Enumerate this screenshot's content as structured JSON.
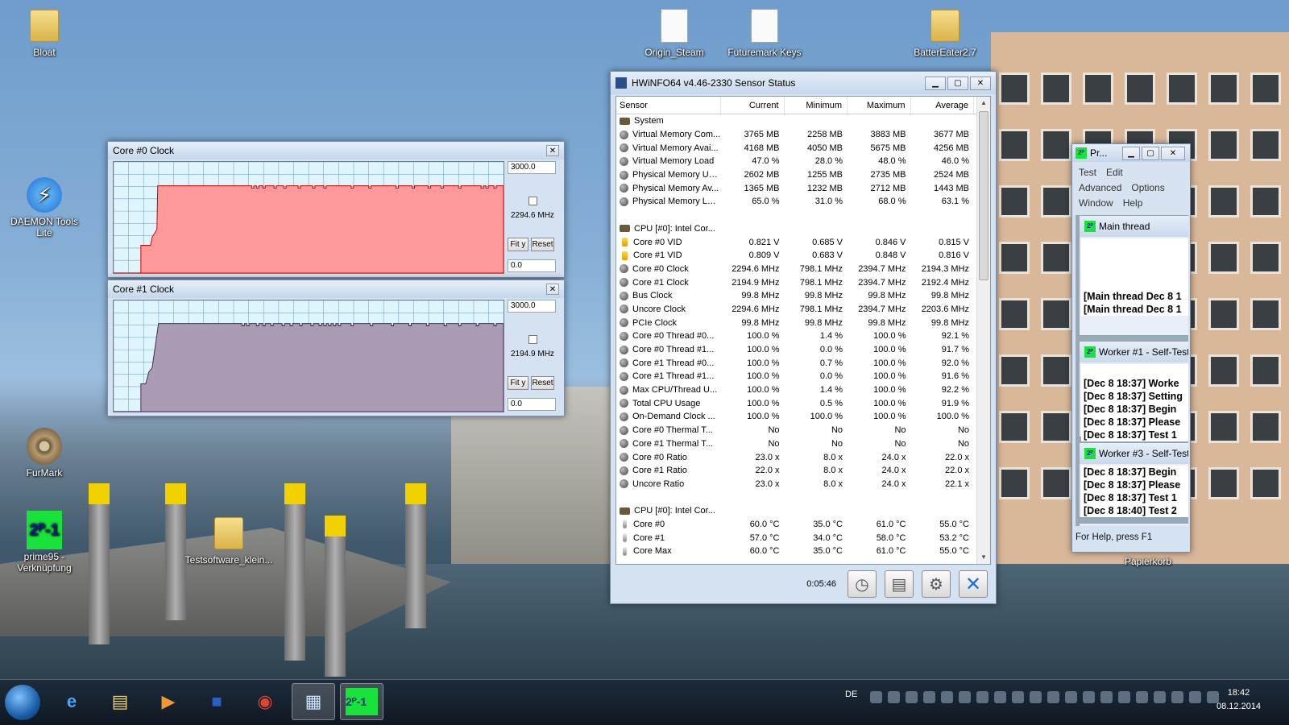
{
  "desktop": {
    "icons": [
      {
        "label": "Bloat",
        "icon": "folder-icon"
      },
      {
        "label": "Origin_Steam",
        "icon": "document-icon"
      },
      {
        "label": "Futuremark Keys",
        "icon": "document-icon"
      },
      {
        "label": "BatterEater2.7",
        "icon": "folder-icon"
      },
      {
        "label": "DAEMON Tools Lite",
        "icon": "daemon-tools-icon"
      },
      {
        "label": "FurMark",
        "icon": "furmark-icon"
      },
      {
        "label": "prime95 - Verknüpfung",
        "icon": "prime95-icon"
      },
      {
        "label": "Testsoftware_klein...",
        "icon": "folder-icon"
      },
      {
        "label": "Papierkorb",
        "icon": "recycle-bin-icon"
      }
    ]
  },
  "graphs": [
    {
      "title": "Core #0 Clock",
      "max": "3000.0",
      "current": "2294.6 MHz",
      "min": "0.0",
      "fit_label": "Fit y",
      "reset_label": "Reset",
      "fill": "#ff9a9a",
      "stroke": "#d40000"
    },
    {
      "title": "Core #1 Clock",
      "max": "3000.0",
      "current": "2194.9 MHz",
      "min": "0.0",
      "fit_label": "Fit y",
      "reset_label": "Reset",
      "fill": "#a99cb3",
      "stroke": "#4a2a58"
    }
  ],
  "hwinfo": {
    "title": "HWiNFO64 v4.46-2330 Sensor Status",
    "columns": [
      "Sensor",
      "Current",
      "Minimum",
      "Maximum",
      "Average"
    ],
    "rows": [
      {
        "icon": "group",
        "cells": [
          "System",
          "",
          "",
          "",
          ""
        ]
      },
      {
        "icon": "sensor",
        "cells": [
          "Virtual Memory Com...",
          "3765 MB",
          "2258 MB",
          "3883 MB",
          "3677 MB"
        ]
      },
      {
        "icon": "sensor",
        "cells": [
          "Virtual Memory Avai...",
          "4168 MB",
          "4050 MB",
          "5675 MB",
          "4256 MB"
        ]
      },
      {
        "icon": "sensor",
        "cells": [
          "Virtual Memory Load",
          "47.0 %",
          "28.0 %",
          "48.0 %",
          "46.0 %"
        ]
      },
      {
        "icon": "sensor",
        "cells": [
          "Physical Memory Used",
          "2602 MB",
          "1255 MB",
          "2735 MB",
          "2524 MB"
        ]
      },
      {
        "icon": "sensor",
        "cells": [
          "Physical Memory Av...",
          "1365 MB",
          "1232 MB",
          "2712 MB",
          "1443 MB"
        ]
      },
      {
        "icon": "sensor",
        "cells": [
          "Physical Memory Load",
          "65.0 %",
          "31.0 %",
          "68.0 %",
          "63.1 %"
        ]
      },
      {
        "icon": "none",
        "cells": [
          "",
          "",
          "",
          "",
          ""
        ]
      },
      {
        "icon": "group",
        "cells": [
          "CPU [#0]: Intel Cor...",
          "",
          "",
          "",
          ""
        ]
      },
      {
        "icon": "volt",
        "cells": [
          "Core #0 VID",
          "0.821 V",
          "0.685 V",
          "0.846 V",
          "0.815 V"
        ]
      },
      {
        "icon": "volt",
        "cells": [
          "Core #1 VID",
          "0.809 V",
          "0.683 V",
          "0.848 V",
          "0.816 V"
        ]
      },
      {
        "icon": "sensor",
        "cells": [
          "Core #0 Clock",
          "2294.6 MHz",
          "798.1 MHz",
          "2394.7 MHz",
          "2194.3 MHz"
        ]
      },
      {
        "icon": "sensor",
        "cells": [
          "Core #1 Clock",
          "2194.9 MHz",
          "798.1 MHz",
          "2394.7 MHz",
          "2192.4 MHz"
        ]
      },
      {
        "icon": "sensor",
        "cells": [
          "Bus Clock",
          "99.8 MHz",
          "99.8 MHz",
          "99.8 MHz",
          "99.8 MHz"
        ]
      },
      {
        "icon": "sensor",
        "cells": [
          "Uncore Clock",
          "2294.6 MHz",
          "798.1 MHz",
          "2394.7 MHz",
          "2203.6 MHz"
        ]
      },
      {
        "icon": "sensor",
        "cells": [
          "PCIe Clock",
          "99.8 MHz",
          "99.8 MHz",
          "99.8 MHz",
          "99.8 MHz"
        ]
      },
      {
        "icon": "sensor",
        "cells": [
          "Core #0 Thread #0...",
          "100.0 %",
          "1.4 %",
          "100.0 %",
          "92.1 %"
        ]
      },
      {
        "icon": "sensor",
        "cells": [
          "Core #0 Thread #1...",
          "100.0 %",
          "0.0 %",
          "100.0 %",
          "91.7 %"
        ]
      },
      {
        "icon": "sensor",
        "cells": [
          "Core #1 Thread #0...",
          "100.0 %",
          "0.7 %",
          "100.0 %",
          "92.0 %"
        ]
      },
      {
        "icon": "sensor",
        "cells": [
          "Core #1 Thread #1...",
          "100.0 %",
          "0.0 %",
          "100.0 %",
          "91.6 %"
        ]
      },
      {
        "icon": "sensor",
        "cells": [
          "Max CPU/Thread U...",
          "100.0 %",
          "1.4 %",
          "100.0 %",
          "92.2 %"
        ]
      },
      {
        "icon": "sensor",
        "cells": [
          "Total CPU Usage",
          "100.0 %",
          "0.5 %",
          "100.0 %",
          "91.9 %"
        ]
      },
      {
        "icon": "sensor",
        "cells": [
          "On-Demand Clock ...",
          "100.0 %",
          "100.0 %",
          "100.0 %",
          "100.0 %"
        ]
      },
      {
        "icon": "sensor",
        "cells": [
          "Core #0 Thermal T...",
          "No",
          "No",
          "No",
          "No"
        ]
      },
      {
        "icon": "sensor",
        "cells": [
          "Core #1 Thermal T...",
          "No",
          "No",
          "No",
          "No"
        ]
      },
      {
        "icon": "sensor",
        "cells": [
          "Core #0 Ratio",
          "23.0 x",
          "8.0 x",
          "24.0 x",
          "22.0 x"
        ]
      },
      {
        "icon": "sensor",
        "cells": [
          "Core #1 Ratio",
          "22.0 x",
          "8.0 x",
          "24.0 x",
          "22.0 x"
        ]
      },
      {
        "icon": "sensor",
        "cells": [
          "Uncore Ratio",
          "23.0 x",
          "8.0 x",
          "24.0 x",
          "22.1 x"
        ]
      },
      {
        "icon": "none",
        "cells": [
          "",
          "",
          "",
          "",
          ""
        ]
      },
      {
        "icon": "group",
        "cells": [
          "CPU [#0]: Intel Cor...",
          "",
          "",
          "",
          ""
        ]
      },
      {
        "icon": "temp",
        "cells": [
          "Core #0",
          "60.0 °C",
          "35.0 °C",
          "61.0 °C",
          "55.0 °C"
        ]
      },
      {
        "icon": "temp",
        "cells": [
          "Core #1",
          "57.0 °C",
          "34.0 °C",
          "58.0 °C",
          "53.2 °C"
        ]
      },
      {
        "icon": "temp",
        "cells": [
          "Core Max",
          "60.0 °C",
          "35.0 °C",
          "61.0 °C",
          "55.0 °C"
        ]
      }
    ],
    "timer": "0:05:46"
  },
  "prime95": {
    "title": "Pr...",
    "menu": [
      "Test",
      "Edit",
      "Advanced",
      "Options",
      "Window",
      "Help"
    ],
    "children": [
      {
        "title": "Main thread",
        "lines": [
          "",
          "",
          "",
          "",
          "[Main thread Dec 8 1",
          "[Main thread Dec 8 1"
        ]
      },
      {
        "title": "Worker #1 - Self-Test",
        "lines": [
          "",
          "[Dec 8 18:37] Worke",
          "[Dec 8 18:37] Setting",
          "[Dec 8 18:37] Begin",
          "[Dec 8 18:37] Please",
          "[Dec 8 18:37] Test 1"
        ]
      },
      {
        "title": "Worker #3 - Self-Test",
        "lines": [
          "[Dec 8 18:37] Begin",
          "[Dec 8 18:37] Please",
          "[Dec 8 18:37] Test 1",
          "[Dec 8 18:40] Test 2"
        ]
      },
      {
        "title": "Worker #4 - Self-Te",
        "lines": []
      }
    ],
    "status": "For Help, press F1"
  },
  "taskbar": {
    "apps": [
      "start-orb",
      "internet-explorer-icon",
      "file-explorer-icon",
      "media-player-icon",
      "floppy-save-icon",
      "chrome-icon",
      "hwinfo-icon",
      "prime95-icon"
    ],
    "language": "DE",
    "time": "18:42",
    "date": "08.12.2014"
  },
  "colors": {
    "graph_grid": "#7aa4c6",
    "graph_bg": "#dff6ff"
  }
}
